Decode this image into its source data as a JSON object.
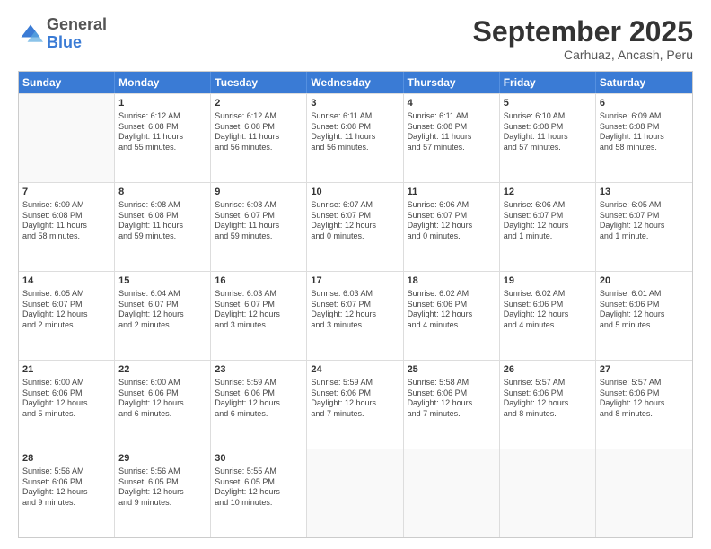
{
  "header": {
    "logo": {
      "general": "General",
      "blue": "Blue"
    },
    "title": "September 2025",
    "subtitle": "Carhuaz, Ancash, Peru"
  },
  "days": [
    "Sunday",
    "Monday",
    "Tuesday",
    "Wednesday",
    "Thursday",
    "Friday",
    "Saturday"
  ],
  "weeks": [
    [
      {
        "day": "",
        "info": ""
      },
      {
        "day": "1",
        "info": "Sunrise: 6:12 AM\nSunset: 6:08 PM\nDaylight: 11 hours\nand 55 minutes."
      },
      {
        "day": "2",
        "info": "Sunrise: 6:12 AM\nSunset: 6:08 PM\nDaylight: 11 hours\nand 56 minutes."
      },
      {
        "day": "3",
        "info": "Sunrise: 6:11 AM\nSunset: 6:08 PM\nDaylight: 11 hours\nand 56 minutes."
      },
      {
        "day": "4",
        "info": "Sunrise: 6:11 AM\nSunset: 6:08 PM\nDaylight: 11 hours\nand 57 minutes."
      },
      {
        "day": "5",
        "info": "Sunrise: 6:10 AM\nSunset: 6:08 PM\nDaylight: 11 hours\nand 57 minutes."
      },
      {
        "day": "6",
        "info": "Sunrise: 6:09 AM\nSunset: 6:08 PM\nDaylight: 11 hours\nand 58 minutes."
      }
    ],
    [
      {
        "day": "7",
        "info": "Sunrise: 6:09 AM\nSunset: 6:08 PM\nDaylight: 11 hours\nand 58 minutes."
      },
      {
        "day": "8",
        "info": "Sunrise: 6:08 AM\nSunset: 6:08 PM\nDaylight: 11 hours\nand 59 minutes."
      },
      {
        "day": "9",
        "info": "Sunrise: 6:08 AM\nSunset: 6:07 PM\nDaylight: 11 hours\nand 59 minutes."
      },
      {
        "day": "10",
        "info": "Sunrise: 6:07 AM\nSunset: 6:07 PM\nDaylight: 12 hours\nand 0 minutes."
      },
      {
        "day": "11",
        "info": "Sunrise: 6:06 AM\nSunset: 6:07 PM\nDaylight: 12 hours\nand 0 minutes."
      },
      {
        "day": "12",
        "info": "Sunrise: 6:06 AM\nSunset: 6:07 PM\nDaylight: 12 hours\nand 1 minute."
      },
      {
        "day": "13",
        "info": "Sunrise: 6:05 AM\nSunset: 6:07 PM\nDaylight: 12 hours\nand 1 minute."
      }
    ],
    [
      {
        "day": "14",
        "info": "Sunrise: 6:05 AM\nSunset: 6:07 PM\nDaylight: 12 hours\nand 2 minutes."
      },
      {
        "day": "15",
        "info": "Sunrise: 6:04 AM\nSunset: 6:07 PM\nDaylight: 12 hours\nand 2 minutes."
      },
      {
        "day": "16",
        "info": "Sunrise: 6:03 AM\nSunset: 6:07 PM\nDaylight: 12 hours\nand 3 minutes."
      },
      {
        "day": "17",
        "info": "Sunrise: 6:03 AM\nSunset: 6:07 PM\nDaylight: 12 hours\nand 3 minutes."
      },
      {
        "day": "18",
        "info": "Sunrise: 6:02 AM\nSunset: 6:06 PM\nDaylight: 12 hours\nand 4 minutes."
      },
      {
        "day": "19",
        "info": "Sunrise: 6:02 AM\nSunset: 6:06 PM\nDaylight: 12 hours\nand 4 minutes."
      },
      {
        "day": "20",
        "info": "Sunrise: 6:01 AM\nSunset: 6:06 PM\nDaylight: 12 hours\nand 5 minutes."
      }
    ],
    [
      {
        "day": "21",
        "info": "Sunrise: 6:00 AM\nSunset: 6:06 PM\nDaylight: 12 hours\nand 5 minutes."
      },
      {
        "day": "22",
        "info": "Sunrise: 6:00 AM\nSunset: 6:06 PM\nDaylight: 12 hours\nand 6 minutes."
      },
      {
        "day": "23",
        "info": "Sunrise: 5:59 AM\nSunset: 6:06 PM\nDaylight: 12 hours\nand 6 minutes."
      },
      {
        "day": "24",
        "info": "Sunrise: 5:59 AM\nSunset: 6:06 PM\nDaylight: 12 hours\nand 7 minutes."
      },
      {
        "day": "25",
        "info": "Sunrise: 5:58 AM\nSunset: 6:06 PM\nDaylight: 12 hours\nand 7 minutes."
      },
      {
        "day": "26",
        "info": "Sunrise: 5:57 AM\nSunset: 6:06 PM\nDaylight: 12 hours\nand 8 minutes."
      },
      {
        "day": "27",
        "info": "Sunrise: 5:57 AM\nSunset: 6:06 PM\nDaylight: 12 hours\nand 8 minutes."
      }
    ],
    [
      {
        "day": "28",
        "info": "Sunrise: 5:56 AM\nSunset: 6:06 PM\nDaylight: 12 hours\nand 9 minutes."
      },
      {
        "day": "29",
        "info": "Sunrise: 5:56 AM\nSunset: 6:05 PM\nDaylight: 12 hours\nand 9 minutes."
      },
      {
        "day": "30",
        "info": "Sunrise: 5:55 AM\nSunset: 6:05 PM\nDaylight: 12 hours\nand 10 minutes."
      },
      {
        "day": "",
        "info": ""
      },
      {
        "day": "",
        "info": ""
      },
      {
        "day": "",
        "info": ""
      },
      {
        "day": "",
        "info": ""
      }
    ]
  ]
}
